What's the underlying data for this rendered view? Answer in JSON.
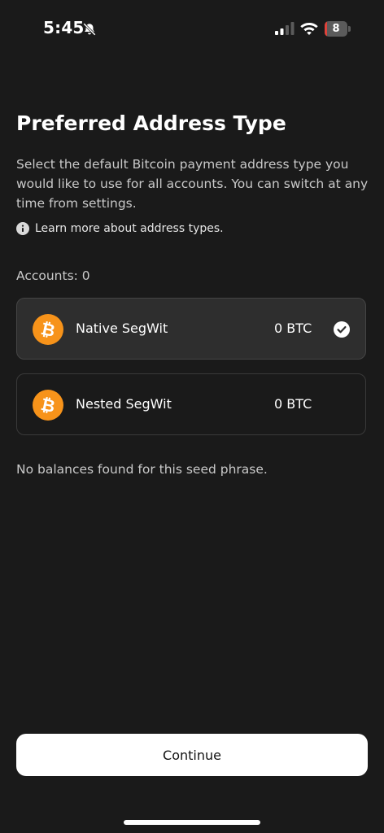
{
  "status_bar": {
    "time": "5:45",
    "battery_level": "8",
    "battery_fraction": 0.08,
    "icons": [
      "bell-slash-icon",
      "cellular-signal-icon",
      "wifi-icon",
      "battery-icon"
    ]
  },
  "title": "Preferred Address Type",
  "description": "Select the default Bitcoin payment address type you would like to use for all accounts. You can switch at any time from settings.",
  "learn_more": {
    "icon": "info-icon",
    "label": "Learn more about address types."
  },
  "accounts_label": "Accounts: 0",
  "options": [
    {
      "name": "Native SegWit",
      "balance": "0 BTC",
      "selected": true,
      "icon": "bitcoin-icon"
    },
    {
      "name": "Nested SegWit",
      "balance": "0 BTC",
      "selected": false,
      "icon": "bitcoin-icon"
    }
  ],
  "no_balance_message": "No balances found for this seed phrase.",
  "continue_label": "Continue",
  "colors": {
    "background": "#1a1a1a",
    "card_selected": "#2e2e2e",
    "card_border": "#3a3a3a",
    "bitcoin_orange": "#f7931a",
    "button_bg": "#ffffff",
    "battery_low": "#e0423a"
  }
}
